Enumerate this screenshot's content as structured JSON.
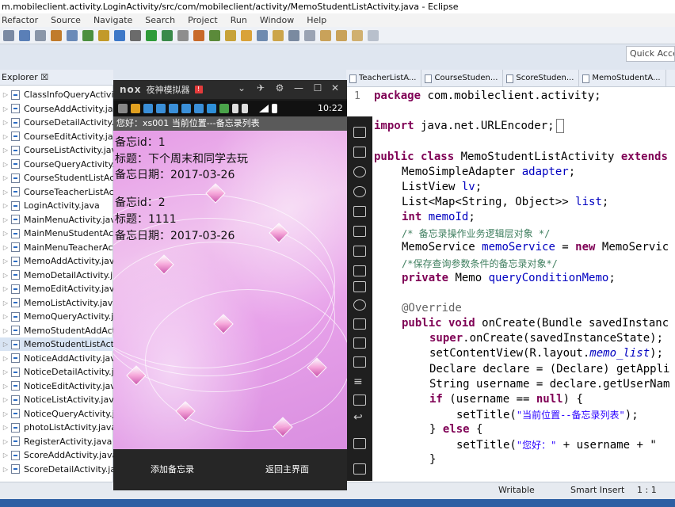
{
  "window": {
    "title": "m.mobileclient.activity.LoginActivity/src/com/mobileclient/activity/MemoStudentListActivity.java - Eclipse"
  },
  "menu": [
    "Refactor",
    "Source",
    "Navigate",
    "Search",
    "Project",
    "Run",
    "Window",
    "Help"
  ],
  "quick_access": "Quick Access",
  "explorer": {
    "tab_label": "Explorer ☒",
    "files": [
      "ClassInfoQueryActivity.java",
      "CourseAddActivity.java",
      "CourseDetailActivity.java",
      "CourseEditActivity.java",
      "CourseListActivity.java",
      "CourseQueryActivity.java",
      "CourseStudentListActivity.java",
      "CourseTeacherListActivity.java",
      "LoginActivity.java",
      "MainMenuActivity.java",
      "MainMenuStudentActivity.java",
      "MainMenuTeacherActivity.java",
      "MemoAddActivity.java",
      "MemoDetailActivity.java",
      "MemoEditActivity.java",
      "MemoListActivity.java",
      "MemoQueryActivity.java",
      "MemoStudentAddActivity.java",
      "MemoStudentListActivity.java",
      "NoticeAddActivity.java",
      "NoticeDetailActivity.java",
      "NoticeEditActivity.java",
      "NoticeListActivity.java",
      "NoticeQueryActivity.java",
      "photoListActivity.java",
      "RegisterActivity.java",
      "ScoreAddActivity.java",
      "ScoreDetailActivity.java"
    ],
    "selected_index": 18
  },
  "editor": {
    "tabs": [
      "TeacherListA...",
      "CourseStuden...",
      "ScoreStuden...",
      "MemoStudentA..."
    ],
    "line_number": "1"
  },
  "code": {
    "l1_kw": "package",
    "l1_rest": " com.mobileclient.activity;",
    "l2_kw": "import",
    "l2_rest": " java.net.URLEncoder;",
    "l3_kw1": "public class",
    "l3_name": " MemoStudentListActivity ",
    "l3_kw2": "extends",
    "l4_type": "MemoSimpleAdapter ",
    "l4_fld": "adapter",
    "l4_end": ";",
    "l5_type": "ListView ",
    "l5_fld": "lv",
    "l5_end": ";",
    "l6_type": "List<Map<String, Object>> ",
    "l6_fld": "list",
    "l6_end": ";",
    "l7_kw": "int",
    "l7_fld": " memoId",
    "l7_end": ";",
    "l8_cmt": "/* 备忘录操作业务逻辑层对象 */",
    "l9_type": "MemoService ",
    "l9_fld": "memoService",
    "l9_mid": " = ",
    "l9_kw": "new",
    "l9_end": " MemoServic",
    "l10_cmt": "/*保存查询参数条件的备忘录对象*/",
    "l11_kw": "private",
    "l11_type": " Memo ",
    "l11_fld": "queryConditionMemo",
    "l11_end": ";",
    "l12_ann": "@Override",
    "l13_kw": "public void",
    "l13_rest": " onCreate(Bundle savedInstanc",
    "l14_kw": "super",
    "l14_rest": ".onCreate(savedInstanceState);",
    "l15_a": "setContentView(R.layout.",
    "l15_b": "memo_list",
    "l15_c": ");",
    "l16": "Declare declare = (Declare) getAppli",
    "l17": "String username = declare.getUserNam",
    "l18_kw": "if",
    "l18_a": " (username == ",
    "l18_kw2": "null",
    "l18_b": ") {",
    "l19_a": "setTitle(",
    "l19_str": "\"当前位置--备忘录列表\"",
    "l19_b": ");",
    "l20_a": "} ",
    "l20_kw": "else",
    "l20_b": " {",
    "l21_a": "setTitle(",
    "l21_str": "\"您好：\"",
    "l21_b": " + username + \"",
    "l22": "}"
  },
  "status": {
    "mode": "Writable",
    "insert": "Smart Insert",
    "position": "1 : 1"
  },
  "emulator": {
    "logo": "nox",
    "name": "夜神模拟器",
    "badge": "!",
    "clock": "10:22",
    "header": "您好：xs001  当前位置---备忘录列表",
    "memos": [
      {
        "id": "备忘id：1",
        "title": "标题：下个周末和同学去玩",
        "date": "备忘日期：2017-03-26"
      },
      {
        "id": "备忘id：2",
        "title": "标题：1111",
        "date": "备忘日期：2017-03-26"
      }
    ],
    "btn_add": "添加备忘录",
    "btn_home": "返回主界面"
  },
  "icons": {
    "minimize": "—",
    "maximize": "☐",
    "close": "✕",
    "collapse": "⌄",
    "menu": "≡"
  }
}
